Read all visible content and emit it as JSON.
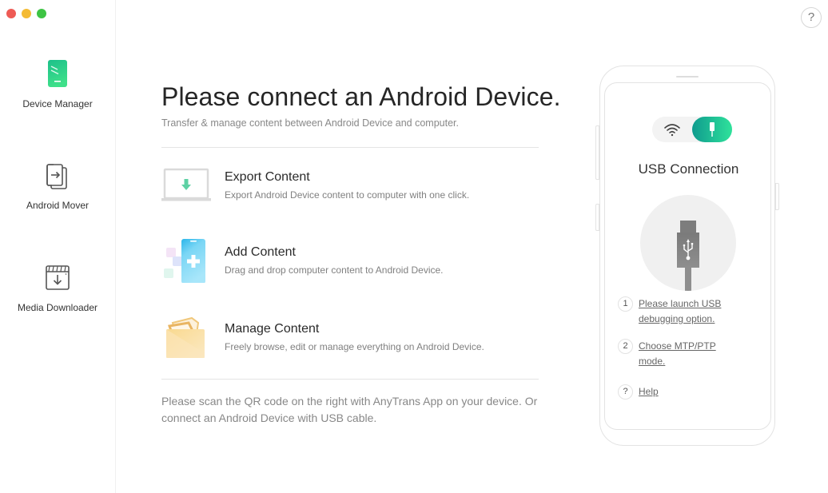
{
  "window": {
    "traffic_lights": [
      "close",
      "minimize",
      "maximize"
    ],
    "colors": {
      "close": "#ee5b55",
      "minimize": "#f4bb34",
      "maximize": "#3ec444"
    }
  },
  "sidebar": {
    "items": [
      {
        "label": "Device Manager",
        "icon": "phone-icon",
        "active": true
      },
      {
        "label": "Android Mover",
        "icon": "transfer-icon",
        "active": false
      },
      {
        "label": "Media Downloader",
        "icon": "download-icon",
        "active": false
      }
    ]
  },
  "header": {
    "help_label": "?"
  },
  "main": {
    "title": "Please connect an Android Device.",
    "subtitle": "Transfer & manage content between Android Device and computer.",
    "features": [
      {
        "title": "Export Content",
        "description": "Export Android Device content to computer with one click.",
        "icon": "laptop-download-icon"
      },
      {
        "title": "Add Content",
        "description": "Drag and drop computer content to Android Device.",
        "icon": "phone-add-icon"
      },
      {
        "title": "Manage Content",
        "description": "Freely browse, edit or manage everything on Android Device.",
        "icon": "folder-icon"
      }
    ],
    "scan_note": "Please scan the QR code on the right with AnyTrans App on your device. Or connect an Android Device with USB cable."
  },
  "phone_panel": {
    "toggle": {
      "options": [
        "wifi",
        "usb"
      ],
      "selected": "usb"
    },
    "connection_title": "USB Connection",
    "steps": [
      {
        "marker": "1",
        "text": "Please launch USB debugging option."
      },
      {
        "marker": "2",
        "text": "Choose MTP/PTP mode."
      },
      {
        "marker": "?",
        "text": "Help"
      }
    ],
    "accent_gradient": [
      "#0f9b8e",
      "#2fe29b"
    ]
  }
}
